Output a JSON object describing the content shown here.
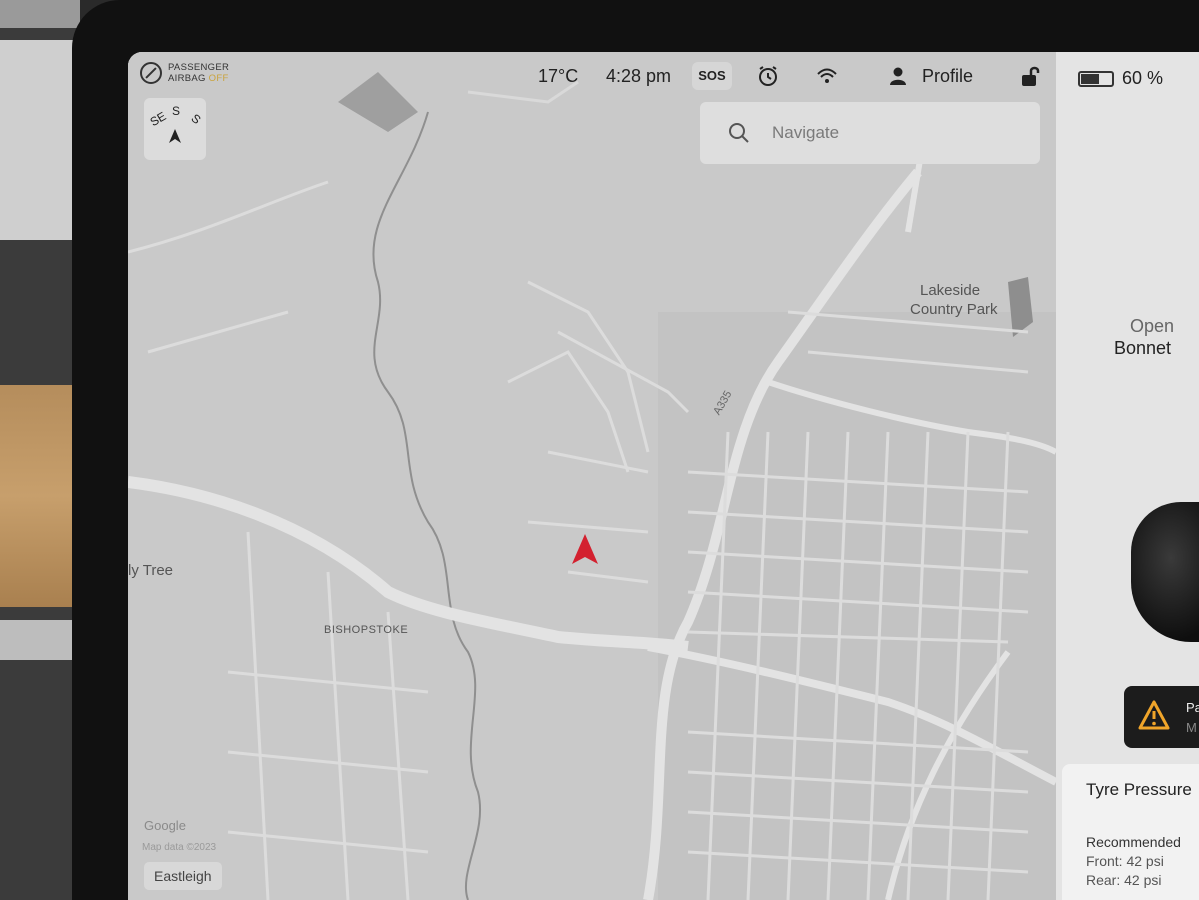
{
  "status_bar": {
    "airbag_line1": "PASSENGER",
    "airbag_line2": "AIRBAG",
    "airbag_state": "OFF",
    "temperature": "17°C",
    "time": "4:28 pm",
    "sos_label": "SOS",
    "profile_label": "Profile",
    "battery_percent": "60 %",
    "battery_level": 0.6
  },
  "compass": {
    "s_left": "SE",
    "s_center": "S",
    "s_right": "S"
  },
  "search": {
    "placeholder": "Navigate"
  },
  "map": {
    "labels": {
      "lakeside_1": "Lakeside",
      "lakeside_2": "Country Park",
      "holly_tree": "ly Tree",
      "bishopstoke": "BISHOPSTOKE",
      "road_a335": "A335"
    },
    "attribution": "Google",
    "map_data": "Map data ©2023",
    "location_chip": "Eastleigh",
    "accent_color": "#d3212f"
  },
  "panel": {
    "bonnet_open": "Open",
    "bonnet_label": "Bonnet",
    "alert_line1": "Pa",
    "alert_line2": "M",
    "tyre_title": "Tyre Pressure",
    "recommended_label": "Recommended",
    "front": "Front: 42 psi",
    "rear": "Rear: 42 psi"
  }
}
